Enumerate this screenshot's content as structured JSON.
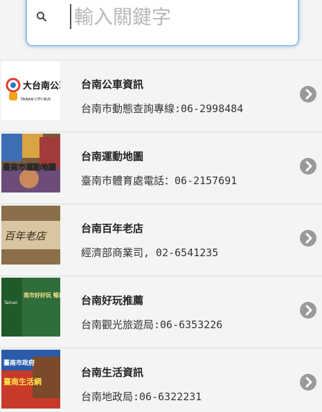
{
  "search": {
    "placeholder": "輸入關鍵字",
    "icon": "search-icon"
  },
  "items": [
    {
      "title": "台南公車資訊",
      "subtitle": "台南市動態查詢專線:06-2998484",
      "thumb_text": "大台南公車",
      "thumb_caption": "TAINAN CITY BUS"
    },
    {
      "title": "台南運動地圖",
      "subtitle": "臺南市體育處電話：06-2157691",
      "thumb_text": "臺南市運動地圖"
    },
    {
      "title": "台南百年老店",
      "subtitle": "經濟部商業司, 02-6541235",
      "thumb_text": "百年老店"
    },
    {
      "title": "台南好玩推薦",
      "subtitle": "台南觀光旅遊局:06-6353226",
      "thumb_text": "南市好好玩 暢遊行程",
      "thumb_caption": "Tainan"
    },
    {
      "title": "台南生活資訊",
      "subtitle": "台南地政局:06-6322231",
      "thumb_text": "臺南生活網",
      "thumb_caption": "臺南市政府"
    }
  ],
  "colors": {
    "search_border": "#9cc4e4",
    "chevron": "#9a9a9a",
    "background": "#f4f4f4"
  }
}
